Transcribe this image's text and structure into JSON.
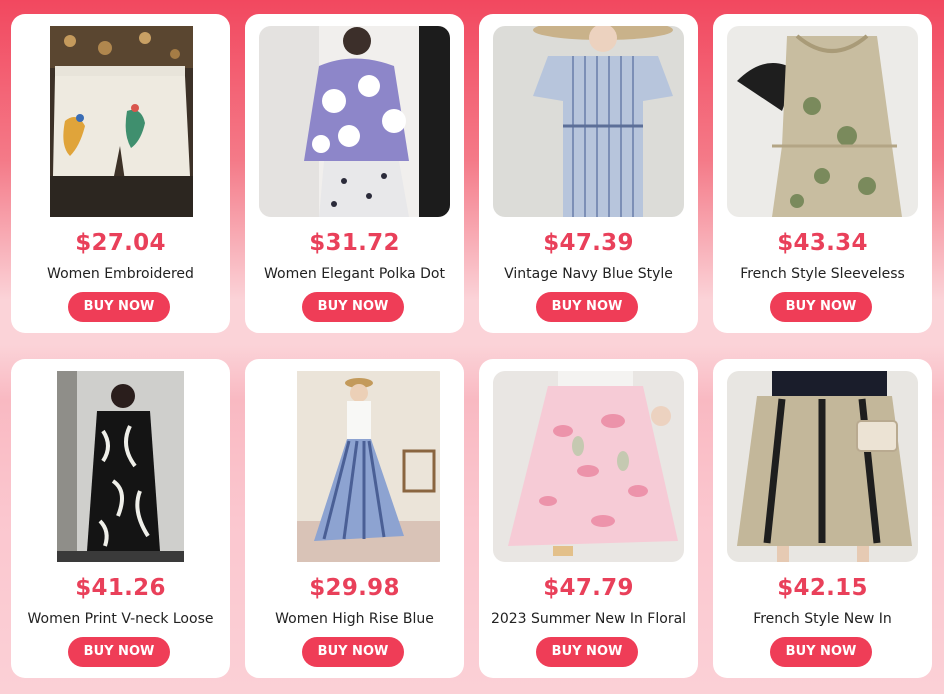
{
  "products": [
    {
      "price": "$27.04",
      "title": "Women Embroidered",
      "button": "BUY NOW",
      "image": "embroidered-denim-shorts-photo"
    },
    {
      "price": "$31.72",
      "title": "Women Elegant Polka Dot",
      "button": "BUY NOW",
      "image": "polka-dot-top-photo"
    },
    {
      "price": "$47.39",
      "title": "Vintage Navy Blue Style",
      "button": "BUY NOW",
      "image": "striped-shirt-dress-photo"
    },
    {
      "price": "$43.34",
      "title": "French Style Sleeveless",
      "button": "BUY NOW",
      "image": "halter-print-dress-photo"
    },
    {
      "price": "$41.26",
      "title": "Women Print V-neck Loose",
      "button": "BUY NOW",
      "image": "black-print-dress-photo"
    },
    {
      "price": "$29.98",
      "title": "Women High Rise Blue",
      "button": "BUY NOW",
      "image": "blue-striped-skirt-photo"
    },
    {
      "price": "$47.79",
      "title": "2023 Summer New In Floral",
      "button": "BUY NOW",
      "image": "pink-floral-skirt-photo"
    },
    {
      "price": "$42.15",
      "title": "French Style New In",
      "button": "BUY NOW",
      "image": "beige-striped-skirt-photo"
    }
  ],
  "colors": {
    "accent": "#ef3d57",
    "price": "#e9405a",
    "background_top": "#f2485f",
    "background_bottom": "#fbd0d6"
  }
}
